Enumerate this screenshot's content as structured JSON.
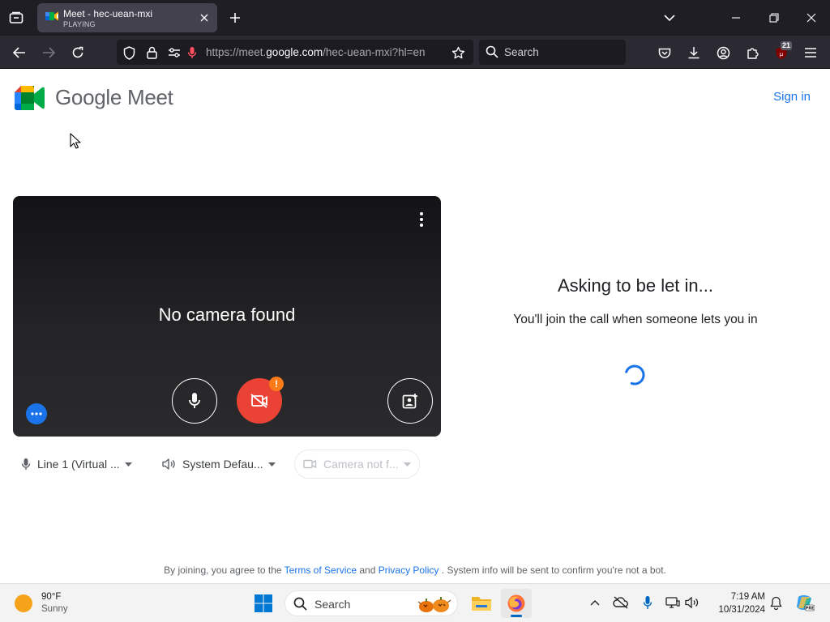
{
  "browser": {
    "tab": {
      "title": "Meet - hec-uean-mxi",
      "status": "PLAYING"
    },
    "url": {
      "prefix": "https://meet.",
      "domain": "google.com",
      "suffix": "/hec-uean-mxi?hl=en"
    },
    "search_placeholder": "Search",
    "extensions_badge": "21"
  },
  "meet": {
    "logo_text": "Google Meet",
    "sign_in": "Sign in",
    "preview": {
      "message": "No camera found",
      "camera_warning": "!"
    },
    "devices": {
      "microphone": "Line 1 (Virtual ...",
      "speaker": "System Defau...",
      "camera": "Camera not f..."
    },
    "status": {
      "title": "Asking to be let in...",
      "subtitle": "You'll join the call when someone lets you in"
    },
    "footer": {
      "before": "By joining, you agree to the",
      "terms": "Terms of Service",
      "and": "and",
      "privacy": "Privacy Policy",
      "after": ". System info will be sent to confirm you're not a bot."
    }
  },
  "taskbar": {
    "weather": {
      "temp": "90°F",
      "condition": "Sunny"
    },
    "search": "Search",
    "clock": {
      "time": "7:19 AM",
      "date": "10/31/2024"
    }
  },
  "colors": {
    "meet_blue": "#1a73e8",
    "cam_off_red": "#ea4335",
    "warning_orange": "#fa7b17",
    "browser_dark": "#1f1e25",
    "toolbar_dark": "#2b2a33"
  }
}
